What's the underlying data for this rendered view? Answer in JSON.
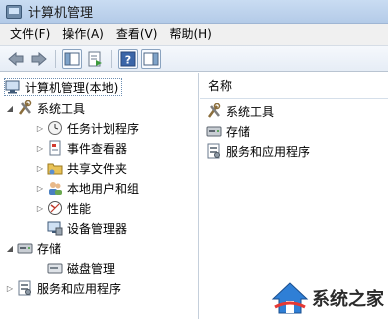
{
  "window": {
    "title": "计算机管理"
  },
  "menu": [
    "文件(F)",
    "操作(A)",
    "查看(V)",
    "帮助(H)"
  ],
  "toolbar": {
    "buttons": [
      "back-icon",
      "forward-icon",
      "show-tree-icon",
      "properties-icon",
      "help-icon",
      "action-pane-icon"
    ]
  },
  "tree": {
    "root": "计算机管理(本地)",
    "system_tools": "系统工具",
    "task_scheduler": "任务计划程序",
    "event_viewer": "事件查看器",
    "shared_folders": "共享文件夹",
    "local_users": "本地用户和组",
    "performance": "性能",
    "device_manager": "设备管理器",
    "storage": "存储",
    "disk_management": "磁盘管理",
    "services_apps": "服务和应用程序"
  },
  "list": {
    "header": "名称",
    "items": [
      "系统工具",
      "存储",
      "服务和应用程序"
    ]
  },
  "watermark": {
    "text": "系统之家"
  }
}
